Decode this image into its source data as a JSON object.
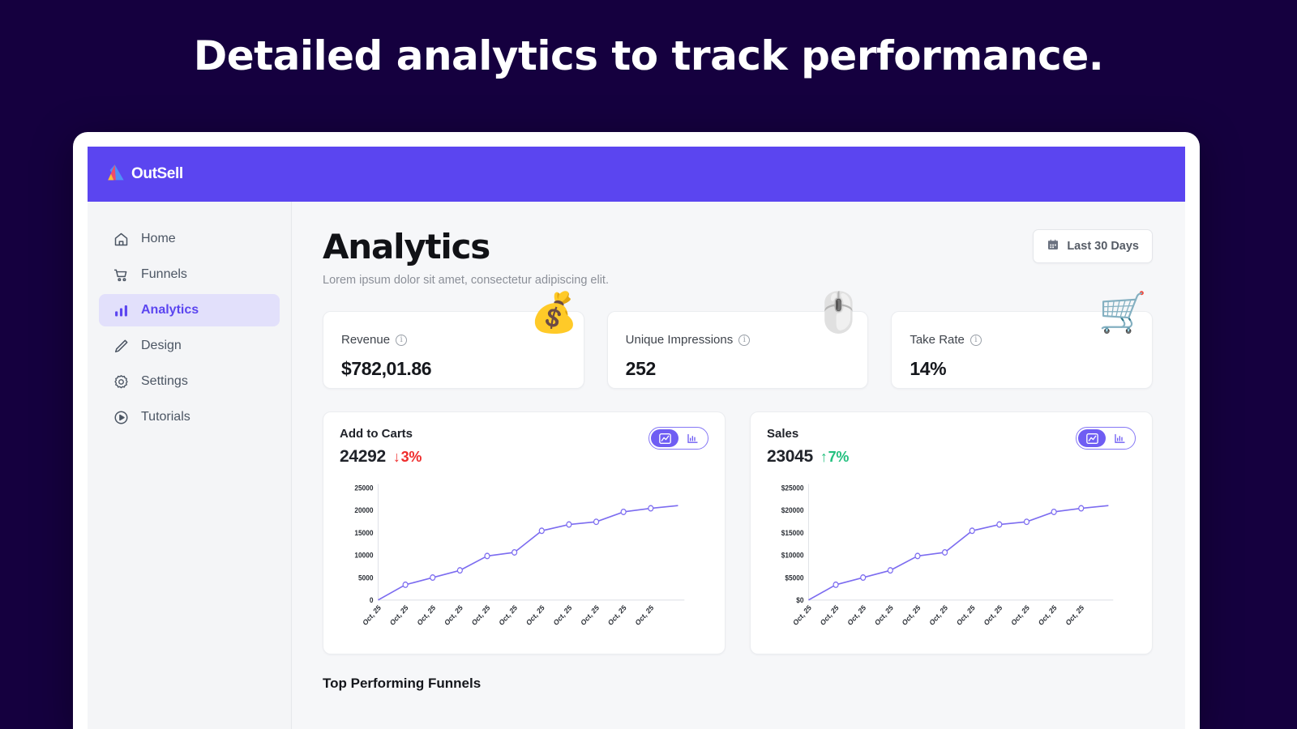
{
  "headline": "Detailed analytics to track performance.",
  "brand": {
    "name": "OutSell",
    "logo_icon": "outsell-triangle-logo",
    "bar_color": "#5b45f0"
  },
  "sidebar": {
    "items": [
      {
        "label": "Home",
        "icon": "home-icon",
        "active": false
      },
      {
        "label": "Funnels",
        "icon": "cart-icon",
        "active": false
      },
      {
        "label": "Analytics",
        "icon": "bar-chart-icon",
        "active": true
      },
      {
        "label": "Design",
        "icon": "pencil-icon",
        "active": false
      },
      {
        "label": "Settings",
        "icon": "gear-icon",
        "active": false
      },
      {
        "label": "Tutorials",
        "icon": "play-circle-icon",
        "active": false
      }
    ]
  },
  "page": {
    "title": "Analytics",
    "subtitle": "Lorem ipsum dolor sit amet, consectetur adipiscing elit.",
    "date_filter": {
      "label": "Last 30 Days",
      "icon": "calendar-icon"
    },
    "section_title": "Top Performing Funnels"
  },
  "stats": [
    {
      "label": "Revenue",
      "value": "$782,01.86",
      "emoji": "💰",
      "icon": "money-bag-emoji"
    },
    {
      "label": "Unique Impressions",
      "value": "252",
      "emoji": "🖱️",
      "icon": "click-board-emoji"
    },
    {
      "label": "Take Rate",
      "value": "14%",
      "emoji": "🛒",
      "icon": "shopping-cart-emoji"
    }
  ],
  "charts": [
    {
      "name": "Add to Carts",
      "value": "24292",
      "delta": "3%",
      "delta_direction": "down",
      "delta_arrow": "↓",
      "delta_color": "#ef2d2d",
      "toggle": {
        "line_label": "line-chart-view",
        "bar_label": "bar-chart-view",
        "selected": "line"
      }
    },
    {
      "name": "Sales",
      "value": "23045",
      "delta": "7%",
      "delta_direction": "up",
      "delta_arrow": "↑",
      "delta_color": "#24c07f",
      "toggle": {
        "line_label": "line-chart-view",
        "bar_label": "bar-chart-view",
        "selected": "line"
      }
    }
  ],
  "chart_data": [
    {
      "type": "line",
      "title": "Add to Carts",
      "xlabel": "",
      "ylabel": "",
      "x": [
        "Oct, 25",
        "Oct, 25",
        "Oct, 25",
        "Oct, 25",
        "Oct, 25",
        "Oct, 25",
        "Oct, 25",
        "Oct, 25",
        "Oct, 25",
        "Oct, 25",
        "Oct, 25"
      ],
      "values": [
        0,
        3300,
        5050,
        6750,
        9900,
        10600,
        15300,
        16700,
        17400,
        19600,
        20300,
        21000
      ],
      "yticks": [
        0,
        5000,
        10000,
        15000,
        20000,
        25000
      ],
      "yticklabels": [
        "0",
        "5000",
        "10000",
        "15000",
        "20000",
        "25000"
      ],
      "ylim": [
        0,
        25000
      ],
      "grid": false,
      "legend": "none",
      "marker": "open-circle",
      "line_color": "#7c6cf0"
    },
    {
      "type": "line",
      "title": "Sales",
      "xlabel": "",
      "ylabel": "",
      "x": [
        "Oct, 25",
        "Oct, 25",
        "Oct, 25",
        "Oct, 25",
        "Oct, 25",
        "Oct, 25",
        "Oct, 25",
        "Oct, 25",
        "Oct, 25",
        "Oct, 25",
        "Oct, 25"
      ],
      "values": [
        0,
        3300,
        5050,
        6750,
        9900,
        10600,
        15300,
        16700,
        17400,
        19600,
        20300,
        21000
      ],
      "yticks": [
        0,
        5000,
        10000,
        15000,
        20000,
        25000
      ],
      "yticklabels": [
        "$0",
        "$5000",
        "$10000",
        "$15000",
        "$20000",
        "$25000"
      ],
      "ylim": [
        0,
        25000
      ],
      "grid": false,
      "legend": "none",
      "marker": "open-circle",
      "line_color": "#7c6cf0"
    }
  ]
}
